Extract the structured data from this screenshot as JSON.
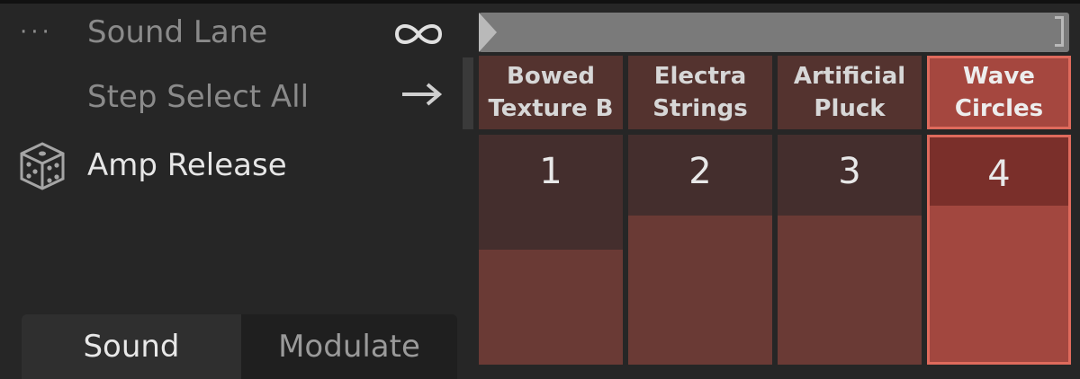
{
  "left_panel": {
    "rows": [
      {
        "label": "Sound Lane",
        "icon": "infinity-icon"
      },
      {
        "label": "Step Select All",
        "icon": "arrow-right-icon"
      },
      {
        "label": "Amp Release",
        "icon": "dice-icon"
      }
    ],
    "tabs": [
      {
        "label": "Sound",
        "selected": true
      },
      {
        "label": "Modulate",
        "selected": false
      }
    ]
  },
  "sounds": [
    {
      "name": "Bowed Texture B",
      "line1": "Bowed",
      "line2": "Texture B"
    },
    {
      "name": "Electra Strings",
      "line1": "Electra",
      "line2": "Strings"
    },
    {
      "name": "Artificial Pluck",
      "line1": "Artificial",
      "line2": "Pluck"
    },
    {
      "name": "Wave Circles",
      "line1": "Wave",
      "line2": "Circles",
      "selected": true
    }
  ],
  "steps": [
    {
      "number": "1",
      "amp_release_level": 0.5
    },
    {
      "number": "2",
      "amp_release_level": 0.65
    },
    {
      "number": "3",
      "amp_release_level": 0.65
    },
    {
      "number": "4",
      "amp_release_level": 0.68,
      "selected": true
    }
  ],
  "colors": {
    "background": "#262626",
    "header_cell": "#54332f",
    "selected_accent": "#df6a5c",
    "step_fill": "#6a3a35"
  }
}
